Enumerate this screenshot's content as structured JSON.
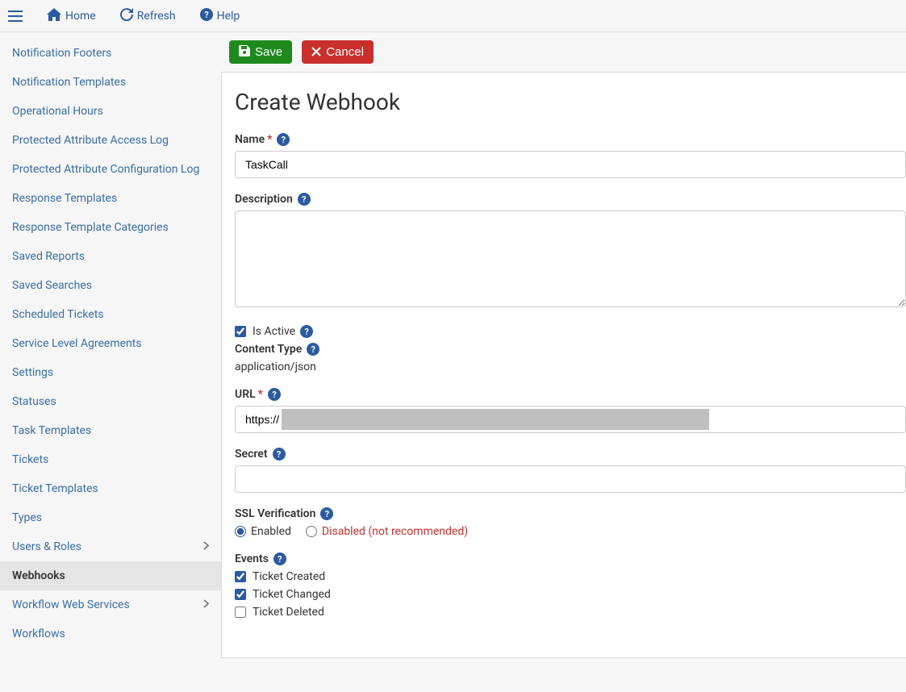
{
  "topbar": {
    "home": "Home",
    "refresh": "Refresh",
    "help": "Help"
  },
  "sidebar": {
    "items": [
      {
        "label": "Notification Footers",
        "hasChevron": false
      },
      {
        "label": "Notification Templates",
        "hasChevron": false
      },
      {
        "label": "Operational Hours",
        "hasChevron": false
      },
      {
        "label": "Protected Attribute Access Log",
        "hasChevron": false
      },
      {
        "label": "Protected Attribute Configuration Log",
        "hasChevron": false
      },
      {
        "label": "Response Templates",
        "hasChevron": false
      },
      {
        "label": "Response Template Categories",
        "hasChevron": false
      },
      {
        "label": "Saved Reports",
        "hasChevron": false
      },
      {
        "label": "Saved Searches",
        "hasChevron": false
      },
      {
        "label": "Scheduled Tickets",
        "hasChevron": false
      },
      {
        "label": "Service Level Agreements",
        "hasChevron": false
      },
      {
        "label": "Settings",
        "hasChevron": false
      },
      {
        "label": "Statuses",
        "hasChevron": false
      },
      {
        "label": "Task Templates",
        "hasChevron": false
      },
      {
        "label": "Tickets",
        "hasChevron": false
      },
      {
        "label": "Ticket Templates",
        "hasChevron": false
      },
      {
        "label": "Types",
        "hasChevron": false
      },
      {
        "label": "Users & Roles",
        "hasChevron": true
      },
      {
        "label": "Webhooks",
        "hasChevron": false,
        "active": true
      },
      {
        "label": "Workflow Web Services",
        "hasChevron": true
      },
      {
        "label": "Workflows",
        "hasChevron": false
      }
    ]
  },
  "actions": {
    "save": "Save",
    "cancel": "Cancel"
  },
  "page": {
    "title": "Create Webhook"
  },
  "form": {
    "name": {
      "label": "Name",
      "value": "TaskCall"
    },
    "description": {
      "label": "Description",
      "value": ""
    },
    "isActive": {
      "label": "Is Active",
      "checked": true
    },
    "contentType": {
      "label": "Content Type",
      "value": "application/json"
    },
    "url": {
      "label": "URL",
      "value": "https://"
    },
    "secret": {
      "label": "Secret",
      "value": ""
    },
    "ssl": {
      "label": "SSL Verification",
      "enabled": "Enabled",
      "disabled": "Disabled (not recommended)",
      "value": "enabled"
    },
    "events": {
      "label": "Events",
      "options": [
        {
          "label": "Ticket Created",
          "checked": true
        },
        {
          "label": "Ticket Changed",
          "checked": true
        },
        {
          "label": "Ticket Deleted",
          "checked": false
        }
      ]
    }
  }
}
